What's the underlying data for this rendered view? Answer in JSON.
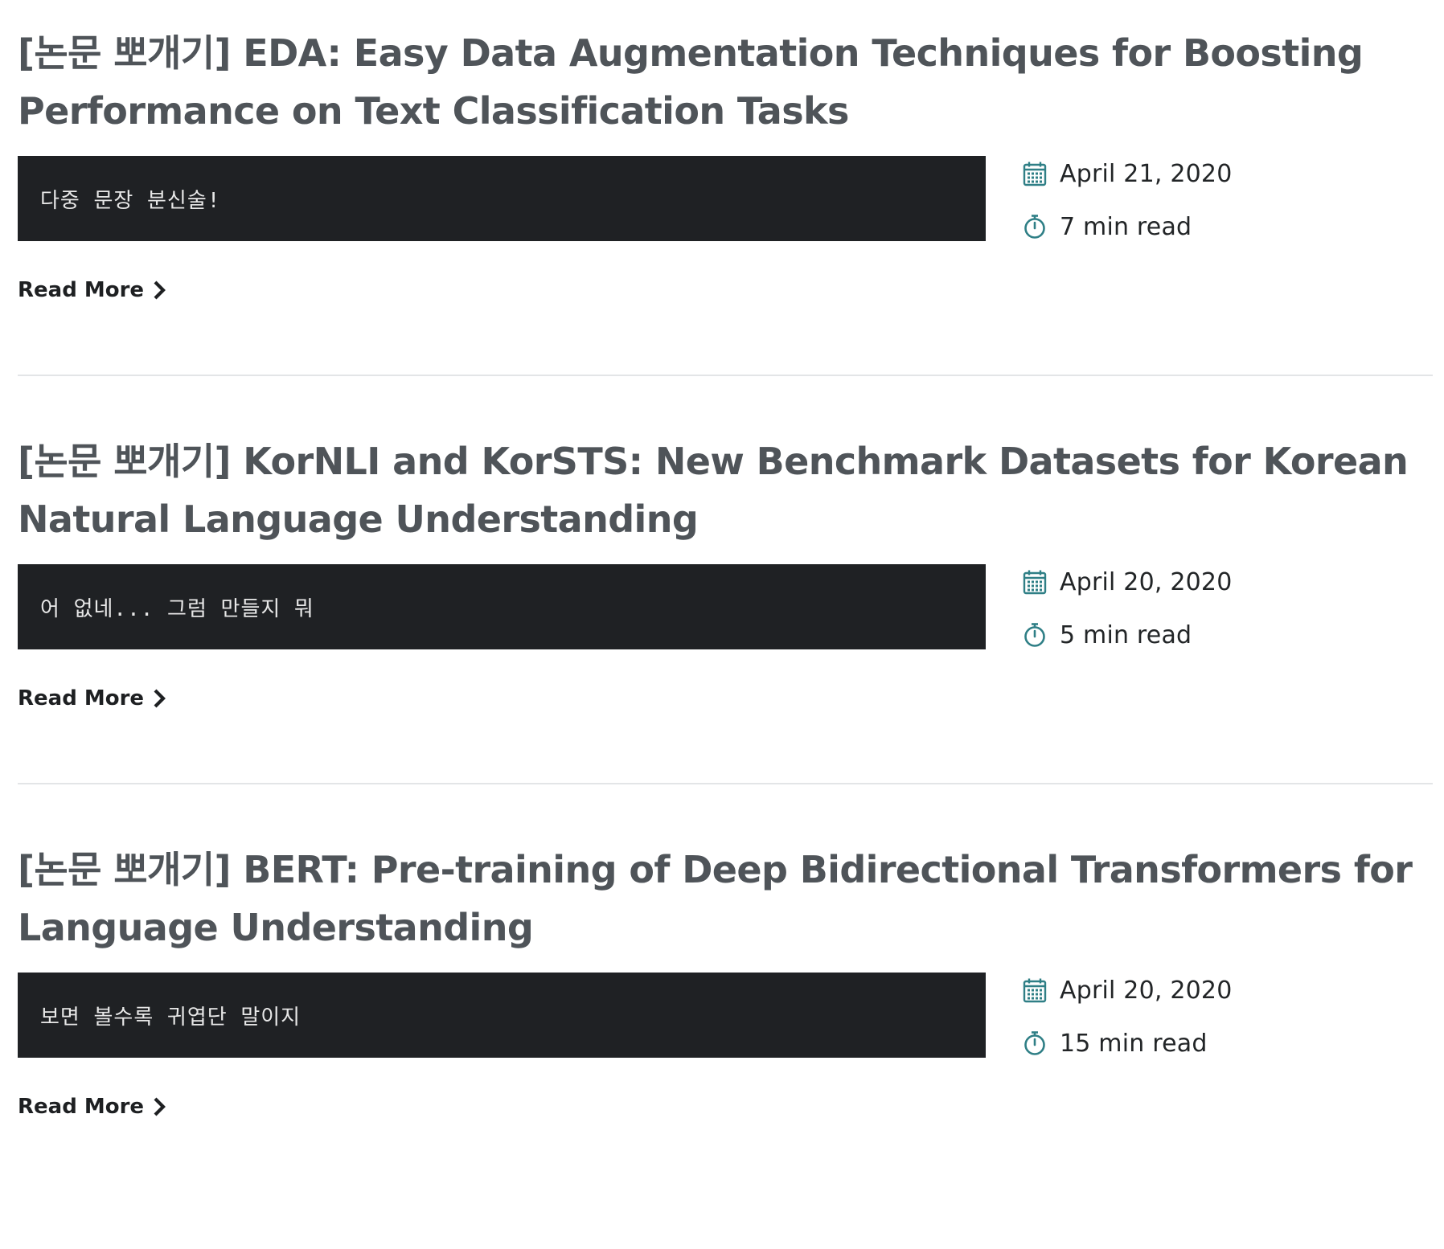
{
  "colors": {
    "title": "#4f5459",
    "excerpt_bg": "#1f2124",
    "excerpt_text": "#e8e8e8",
    "icon_accent": "#2f7f86",
    "divider": "#e3e5e7"
  },
  "posts": [
    {
      "title": "[논문 뽀개기] EDA: Easy Data Augmentation Techniques for Boosting Performance on Text Classification Tasks",
      "excerpt": "다중 문장 분신술!",
      "date": "April 21, 2020",
      "read_time": "7 min read",
      "read_more": "Read More",
      "date_icon": "calendar-icon",
      "time_icon": "stopwatch-icon"
    },
    {
      "title": "[논문 뽀개기] KorNLI and KorSTS: New Benchmark Datasets for Korean Natural Language Understanding",
      "excerpt": "어 없네... 그럼 만들지 뭐",
      "date": "April 20, 2020",
      "read_time": "5 min read",
      "read_more": "Read More",
      "date_icon": "calendar-icon",
      "time_icon": "stopwatch-icon"
    },
    {
      "title": "[논문 뽀개기] BERT: Pre-training of Deep Bidirectional Transformers for Language Understanding",
      "excerpt": "보면 볼수록 귀엽단 말이지",
      "date": "April 20, 2020",
      "read_time": "15 min read",
      "read_more": "Read More",
      "date_icon": "calendar-icon",
      "time_icon": "stopwatch-icon"
    }
  ]
}
